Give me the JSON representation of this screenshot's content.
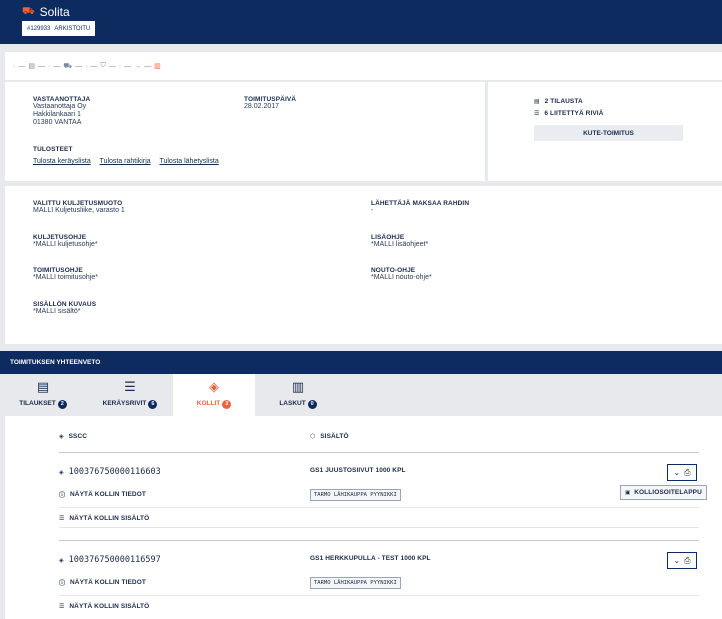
{
  "header": {
    "app_title": "Solita",
    "order_id": "#129933",
    "status": "ARKISTOITU"
  },
  "steps": [
    "·",
    "—",
    "▤",
    "—",
    "·",
    "—",
    "⛟",
    "—",
    "·",
    "—",
    "⛉",
    "—",
    "·",
    "—",
    "→",
    "—",
    "▥"
  ],
  "recipient": {
    "label": "VASTAANOTTAJA",
    "lines": [
      "Vastaanottaja Oy",
      "Hakkilankaari 1",
      "01380 VANTAA"
    ]
  },
  "delivery_date": {
    "label": "TOIMITUSPÄIVÄ",
    "value": "28.02.2017"
  },
  "prints": {
    "label": "TULOSTEET",
    "links": [
      "Tulosta keräyslista",
      "Tulosta rahtikirja",
      "Tulosta lähetyslista"
    ]
  },
  "side": {
    "orders": "2 TILAUSTA",
    "rows": "6 LIITETTYÄ RIVIÄ",
    "kute_button": "KUTE-TOIMITUS"
  },
  "details": {
    "transport_label": "VALITTU KULJETUSMUOTO",
    "transport_value": "MALLI Kuljetusliike, varasto 1",
    "sender_pays_label": "LÄHETTÄJÄ MAKSAA RAHDIN",
    "sender_pays_value": "-",
    "transport_instr_label": "KULJETUSOHJE",
    "transport_instr_value": "*MALLI kuljetusohje*",
    "extra_instr_label": "LISÄOHJE",
    "extra_instr_value": "*MALLI lisäohjeet*",
    "delivery_instr_label": "TOIMITUSOHJE",
    "delivery_instr_value": "*MALLI toimitusohje*",
    "pickup_instr_label": "NOUTO-OHJE",
    "pickup_instr_value": "*MALLI nouto-ohje*",
    "contents_label": "SISÄLLÖN KUVAUS",
    "contents_value": "*MALLI sisältö*"
  },
  "summary": {
    "title": "TOIMITUKSEN YHTEENVETO"
  },
  "tabs": [
    {
      "label": "TILAUKSET",
      "count": "2"
    },
    {
      "label": "KERÄYSRIVIT",
      "count": "6"
    },
    {
      "label": "KOLLIT",
      "count": "3"
    },
    {
      "label": "LASKUT",
      "count": "0"
    }
  ],
  "columns": {
    "sscc": "SSCC",
    "contents": "SISÄLTÖ"
  },
  "parcels": [
    {
      "sscc": "100376750000116603",
      "content": "GS1 JUUSTOSIIVUT 1000 kpl",
      "tag": "TARMO LÄHIKAUPPA PYYNIKKI",
      "info": "NÄYTÄ KOLLIN TIEDOT",
      "show_contents": "NÄYTÄ KOLLIN SISÄLTÖ",
      "dropdown_item": "KOLLIOSOITELAPPU"
    },
    {
      "sscc": "100376750000116597",
      "content": "GS1 HERKKUPULLA - TEST 1000 kpl",
      "tag": "TARMO LÄHIKAUPPA PYYNIKKI",
      "info": "NÄYTÄ KOLLIN TIEDOT",
      "show_contents": "NÄYTÄ KOLLIN SISÄLTÖ"
    }
  ],
  "colors": {
    "navy": "#0d2b5e",
    "accent": "#e8643c",
    "background": "#e8e9ec"
  }
}
